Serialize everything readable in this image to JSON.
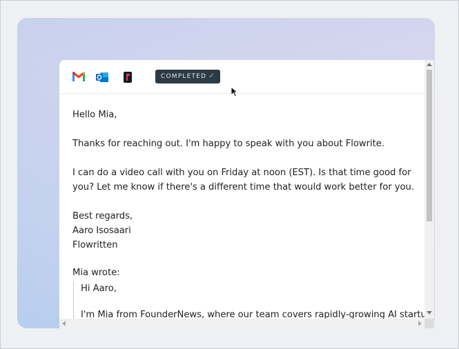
{
  "toolbar": {
    "icons": [
      "gmail-icon",
      "outlook-icon",
      "flowrite-icon"
    ],
    "status_badge": "COMPLETED",
    "status_check": "✓"
  },
  "email": {
    "greeting": "Hello Mia,",
    "paragraph1": "Thanks for reaching out. I'm happy to speak with you about Flowrite.",
    "paragraph2": "I can do a video call with you on Friday at noon (EST). Is that time good for you? Let me know if there's a different time that would work better for you.",
    "closing": "Best regards,",
    "signature_name": "Aaro Isosaari",
    "signature_company": "Flowritten",
    "quote_label": "Mia wrote:",
    "quote_greeting": "Hi Aaro,",
    "quote_body": "I'm Mia from FounderNews, where our team covers rapidly-growing AI startups"
  },
  "colors": {
    "badge_bg": "#2b3a45",
    "gmail_red": "#ea4335",
    "outlook_blue": "#0f6cbd",
    "flowrite_pink": "#ff2e63"
  }
}
